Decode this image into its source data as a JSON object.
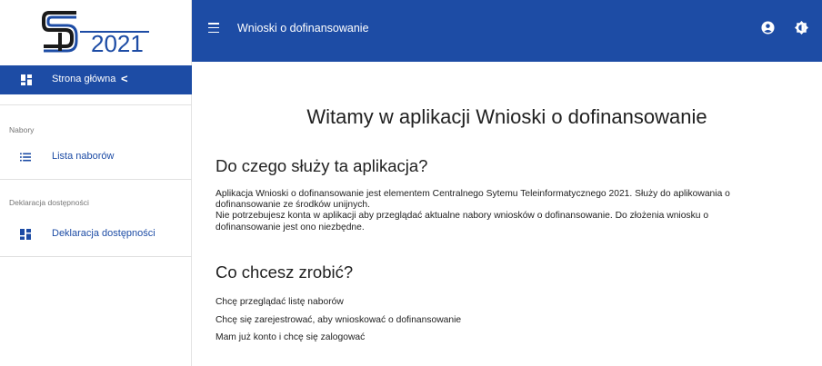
{
  "logo": {
    "text": "2021"
  },
  "sidebar": {
    "home": {
      "label": "Strona główna",
      "chevron": "<"
    },
    "sections": [
      {
        "label": "Nabory",
        "item": {
          "label": "Lista naborów",
          "icon": "list-icon"
        }
      },
      {
        "label": "Deklaracja dostępności",
        "item": {
          "label": "Deklaracja dostępności",
          "icon": "dashboard-icon"
        }
      }
    ]
  },
  "topbar": {
    "title": "Wnioski o dofinansowanie",
    "icons": [
      "menu-icon",
      "account-icon",
      "contrast-icon"
    ]
  },
  "main": {
    "welcome": "Witamy w aplikacji Wnioski o dofinansowanie",
    "purpose_heading": "Do czego służy ta aplikacja?",
    "purpose_lines": [
      "Aplikacja Wnioski o dofinansowanie jest elementem Centralnego Sytemu Teleinformatycznego 2021. Służy do aplikowania o",
      "dofinansowanie ze środków unijnych.",
      "Nie potrzebujesz konta w aplikacji aby przeglądać aktualne nabory wniosków o dofinansowanie. Do złożenia wniosku o",
      "dofinansowanie jest ono niezbędne."
    ],
    "actions_heading": "Co chcesz zrobić?",
    "actions": [
      "Chcę przeglądać listę naborów",
      "Chcę się zarejestrować, aby wnioskować o dofinansowanie",
      "Mam już konto i chcę się zalogować"
    ]
  },
  "colors": {
    "brand": "#1d4ca5",
    "text": "#212121",
    "muted": "#757575"
  }
}
